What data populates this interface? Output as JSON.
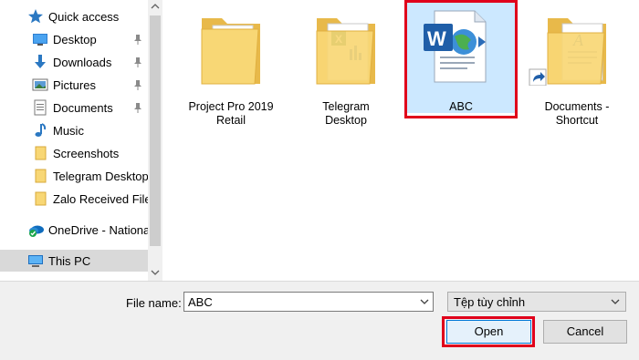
{
  "sidebar": {
    "items": [
      {
        "label": "Quick access",
        "icon": "star-icon",
        "pinned": false
      },
      {
        "label": "Desktop",
        "icon": "desktop-icon",
        "pinned": true
      },
      {
        "label": "Downloads",
        "icon": "download-icon",
        "pinned": true
      },
      {
        "label": "Pictures",
        "icon": "pictures-icon",
        "pinned": true
      },
      {
        "label": "Documents",
        "icon": "documents-icon",
        "pinned": true
      },
      {
        "label": "Music",
        "icon": "music-icon",
        "pinned": false
      },
      {
        "label": "Screenshots",
        "icon": "folder-icon",
        "pinned": false
      },
      {
        "label": "Telegram Desktop",
        "icon": "folder-icon",
        "pinned": false
      },
      {
        "label": "Zalo Received Files",
        "icon": "folder-icon",
        "pinned": false
      },
      {
        "label": "OneDrive - National",
        "icon": "onedrive-icon",
        "pinned": false
      },
      {
        "label": "This PC",
        "icon": "this-pc-icon",
        "pinned": false
      }
    ],
    "selected": "This PC"
  },
  "files": [
    {
      "name_line1": "Project Pro 2019",
      "name_line2": "Retail",
      "icon": "folder-icon"
    },
    {
      "name_line1": "Telegram",
      "name_line2": "Desktop",
      "icon": "folder-excel-icon"
    },
    {
      "name_line1": "ABC",
      "name_line2": "",
      "icon": "word-document-icon",
      "selected": true
    },
    {
      "name_line1": "Documents -",
      "name_line2": "Shortcut",
      "icon": "folder-shortcut-icon"
    }
  ],
  "bottom": {
    "file_name_label": "File name:",
    "file_name_value": "ABC",
    "filter_value": "Tệp tùy chỉnh",
    "open_label": "Open",
    "cancel_label": "Cancel"
  },
  "colors": {
    "highlight": "#e0001b",
    "selection": "#cce8ff",
    "folder": "#f8d775",
    "accent": "#0078d7"
  }
}
